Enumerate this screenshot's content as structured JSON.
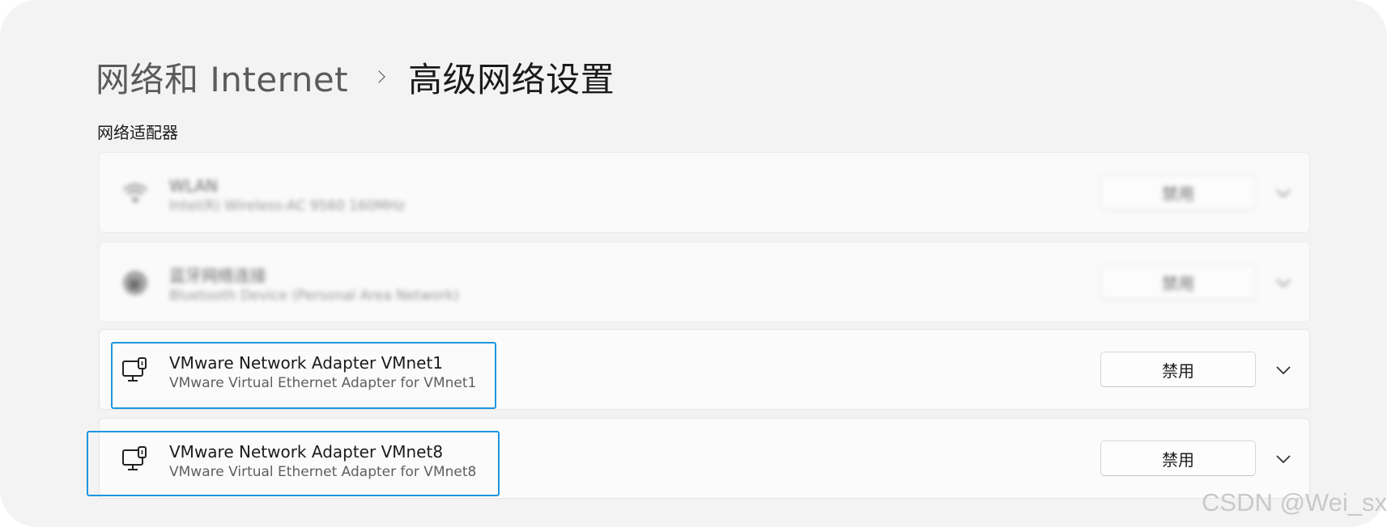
{
  "breadcrumb": {
    "parent": "网络和 Internet",
    "current": "高级网络设置",
    "separator_icon": "chevron-right-icon"
  },
  "section": {
    "title": "网络适配器"
  },
  "adapters": [
    {
      "name": "WLAN",
      "description": "Intel(R) Wireless-AC 9560 160MHz",
      "button_label": "禁用",
      "icon": "wifi-icon",
      "blurred": true
    },
    {
      "name": "蓝牙网络连接",
      "description": "Bluetooth Device (Personal Area Network)",
      "button_label": "禁用",
      "icon": "bluetooth-icon",
      "blurred": true
    },
    {
      "name": "VMware Network Adapter VMnet1",
      "description": "VMware Virtual Ethernet Adapter for VMnet1",
      "button_label": "禁用",
      "icon": "ethernet-pc-icon",
      "blurred": false
    },
    {
      "name": "VMware Network Adapter VMnet8",
      "description": "VMware Virtual Ethernet Adapter for VMnet8",
      "button_label": "禁用",
      "icon": "ethernet-pc-icon",
      "blurred": false
    }
  ],
  "watermark": "CSDN @Wei_sx",
  "colors": {
    "background": "#f3f3f3",
    "card": "#fbfbfb",
    "focus_outline": "#1e96e0",
    "text_primary": "#1b1b1b",
    "text_secondary": "#5f5f5f"
  }
}
